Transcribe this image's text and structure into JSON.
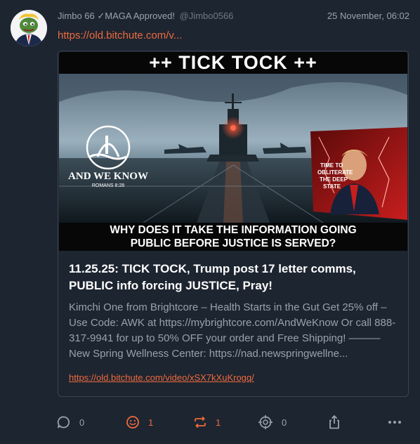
{
  "post": {
    "author_name": "Jimbo 66 ✓MAGA Approved!",
    "author_handle": "@Jimbo0566",
    "timestamp": "25 November, 06:02",
    "short_link": "https://old.bitchute.com/v..."
  },
  "card": {
    "thumbnail": {
      "top_text": "++ TICK TOCK ++",
      "bottom_text_line1": "WHY DOES IT TAKE THE INFORMATION GOING",
      "bottom_text_line2": "PUBLIC BEFORE JUSTICE IS SERVED?",
      "logo_text": "AND WE KNOW",
      "logo_subtext": "ROMANS 8:28",
      "poster_text_1": "TIME TO",
      "poster_text_2": "OBLITERATE",
      "poster_text_3": "THE DEEP",
      "poster_text_4": "STATE"
    },
    "title": "11.25.25: TICK TOCK, Trump post 17 letter comms, PUBLIC info forcing JUSTICE, Pray!",
    "description": "Kimchi One from Brightcore – Health Starts in the Gut Get 25% off – Use Code: AWK at https://mybrightcore.com/AndWeKnow Or call 888-317-9941 for up to 50% OFF your order and Free Shipping! ——— New Spring Wellness Center: https://nad.newspringwellne...",
    "link": "https://old.bitchute.com/video/xSX7kXuKrogq/"
  },
  "actions": {
    "reply_count": "0",
    "react_count": "1",
    "repost_count": "1",
    "quote_count": "0"
  },
  "colors": {
    "accent": "#ee6a3e",
    "background": "#1d2530",
    "muted_text": "#9aa3ad"
  },
  "icons": [
    "reply-icon",
    "smile-icon",
    "repost-icon",
    "crosshair-icon",
    "share-icon",
    "more-icon"
  ]
}
